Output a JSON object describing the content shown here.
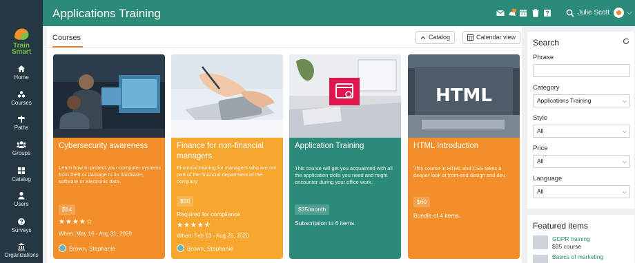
{
  "header": {
    "title": "Applications Training",
    "user_name": "Julie Scott",
    "notification_count": "2"
  },
  "sidebar": {
    "logo_line1": "Train",
    "logo_line2": "Smart",
    "items": [
      {
        "label": "Home",
        "icon": "home-icon"
      },
      {
        "label": "Courses",
        "icon": "courses-icon"
      },
      {
        "label": "Paths",
        "icon": "paths-icon"
      },
      {
        "label": "Groups",
        "icon": "groups-icon"
      },
      {
        "label": "Catalog",
        "icon": "catalog-icon"
      },
      {
        "label": "Users",
        "icon": "users-icon"
      },
      {
        "label": "Surveys",
        "icon": "surveys-icon"
      },
      {
        "label": "Organizations",
        "icon": "organizations-icon"
      }
    ]
  },
  "main": {
    "breadcrumb": "Courses",
    "catalog_button": "Catalog",
    "calendar_button": "Calendar view",
    "cards": [
      {
        "title": "Cybersecurity awareness",
        "description": "Learn how to protect your computer systems from theft or damage to its hardware, software or electronic data.",
        "price": "$14",
        "rating": 4,
        "stars": "★★★★☆",
        "dates": "When: May 16 - Aug 31, 2020",
        "author": "Brown, Stephanie",
        "color": "#f28f2a"
      },
      {
        "title": "Finance for non-financial managers",
        "description": "Financial training for managers who are not part of the financial department of the company",
        "price": "$50",
        "note": "Required for compliance",
        "rating": 4.5,
        "stars": "★★★★⯪",
        "dates": "When: Feb 13 - Aug 25, 2020",
        "author": "Brown, Stephanie",
        "color": "#f7a630"
      },
      {
        "title": "Application Training",
        "description": "This course will get you acquainted with all the application skills you need and might encounter during your office work.",
        "price": "$35/month",
        "note": "Subscription to 6 items.",
        "color": "#2b8a78"
      },
      {
        "title": "HTML Introduction",
        "description": "This course in HTML and CSS takes a deeper look at front-end design and dev.",
        "price": "$60",
        "note": "Bundle of 4 items.",
        "image_text": "HTML",
        "color": "#f28f2a"
      }
    ]
  },
  "search": {
    "title": "Search",
    "phrase_label": "Phrase",
    "phrase_value": "",
    "category_label": "Category",
    "category_value": "Applications Training",
    "style_label": "Style",
    "style_value": "All",
    "price_label": "Price",
    "price_value": "All",
    "language_label": "Language",
    "language_value": "All"
  },
  "featured": {
    "title": "Featured items",
    "items": [
      {
        "name": "GDPR training",
        "price": "$35 course"
      },
      {
        "name": "Basics of marketing",
        "price": ""
      }
    ]
  },
  "colors": {
    "topbar": "#2b8a78",
    "rail": "#243742",
    "accent_orange": "#f28f2a",
    "accent_teal": "#2b8a78"
  }
}
